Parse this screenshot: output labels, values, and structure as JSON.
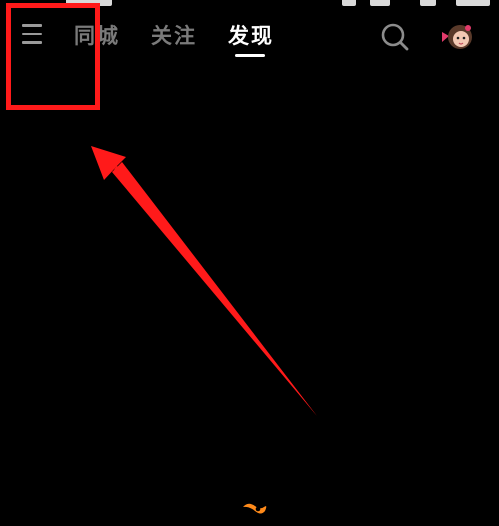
{
  "header": {
    "tabs": [
      {
        "label": "同城",
        "active": false
      },
      {
        "label": "关注",
        "active": false
      },
      {
        "label": "发现",
        "active": true
      }
    ]
  },
  "icons": {
    "menu": "menu-icon",
    "search": "search-icon",
    "avatar": "avatar",
    "loading": "loading-icon"
  },
  "colors": {
    "background": "#000000",
    "active_tab": "#ffffff",
    "inactive_tab": "#7a7a7a",
    "annotation": "#ff1a1a",
    "loading": "#ff8a1a"
  }
}
